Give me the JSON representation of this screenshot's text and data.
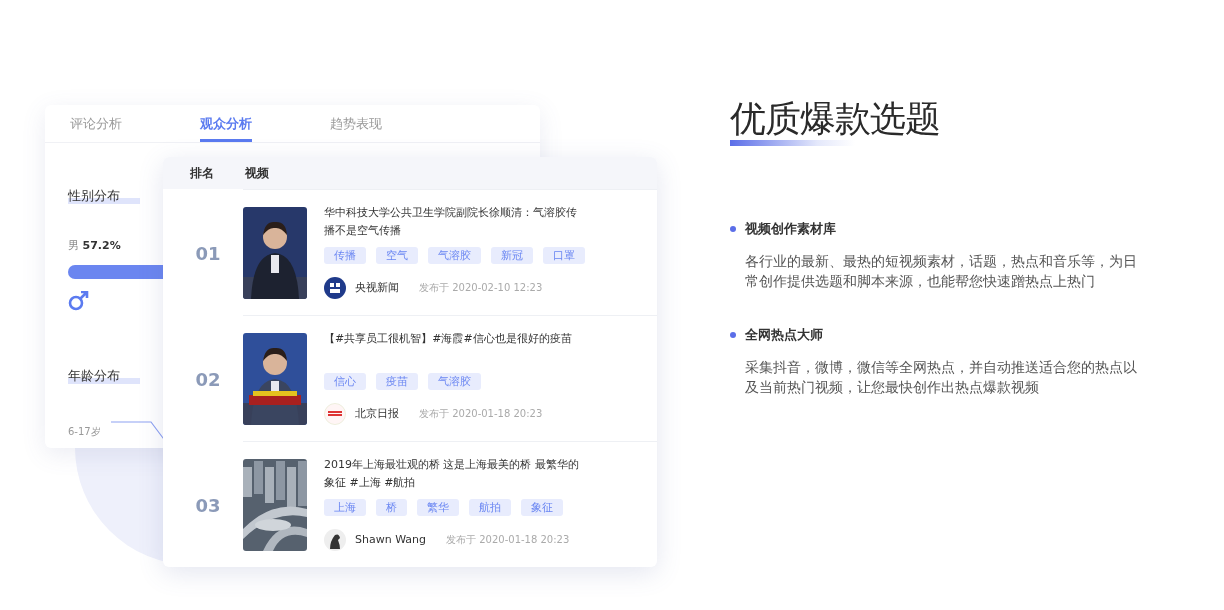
{
  "audience_card": {
    "tabs": [
      {
        "label": "评论分析",
        "selected": false
      },
      {
        "label": "观众分析",
        "selected": true
      },
      {
        "label": "趋势表现",
        "selected": false
      }
    ],
    "gender": {
      "title": "性别分布",
      "label": "男 **57.2%**",
      "level": 0.572
    },
    "age": {
      "title": "年龄分布",
      "range": "6-17岁"
    }
  },
  "ranking_table": {
    "columns": [
      "排名",
      "视频"
    ],
    "rows": [
      {
        "rank": "01",
        "title": "华中科技大学公共卫生学院副院长徐顺清：气溶胶传播不是空气传播",
        "tags": [
          "传播",
          "空气",
          "气溶胶",
          "新冠",
          "口罩"
        ],
        "author": "央视新闻",
        "published": "发布于 2020-02-10  12:23"
      },
      {
        "rank": "02",
        "title": "【#共享员工很机智】#海霞#信心也是很好的疫苗",
        "tags": [
          "信心",
          "疫苗",
          "气溶胶"
        ],
        "author": "北京日报",
        "published": "发布于 2020-01-18  20:23"
      },
      {
        "rank": "03",
        "title": "2019年上海最壮观的桥 这是上海最美的桥 最繁华的象征 #上海 #航拍",
        "tags": [
          "上海",
          "桥",
          "繁华",
          "航拍",
          "象征"
        ],
        "author": "Shawn Wang",
        "published": "发布于 2020-01-18  20:23"
      }
    ]
  },
  "feature": {
    "title": "优质爆款选题",
    "items": [
      {
        "title": "视频创作素材库",
        "description": "各行业的最新、最热的短视频素材，话题，热点和音乐等，为日常创作提供选题和脚本来源，也能帮您快速蹭热点上热门"
      },
      {
        "title": "全网热点大师",
        "description": "采集抖音，微博，微信等全网热点，并自动推送适合您的热点以及当前热门视频，让您最快创作出热点爆款视频"
      }
    ]
  }
}
